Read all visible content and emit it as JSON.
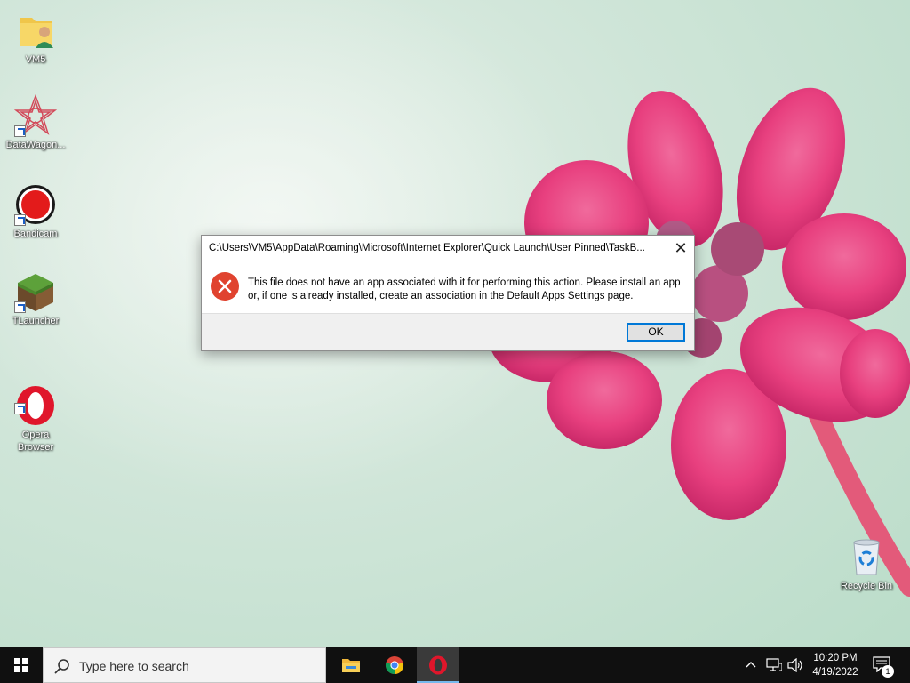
{
  "desktop": {
    "icons": [
      {
        "label": "VM5",
        "icon": "user-folder-icon"
      },
      {
        "label": "DataWagon...",
        "icon": "datawagon-icon"
      },
      {
        "label": "Bandicam",
        "icon": "bandicam-icon"
      },
      {
        "label": "TLauncher",
        "icon": "minecraft-block-icon"
      },
      {
        "label": "Opera\nBrowser",
        "icon": "opera-icon"
      },
      {
        "label": "Recycle Bin",
        "icon": "recycle-bin-icon"
      }
    ]
  },
  "dialog": {
    "title": "C:\\Users\\VM5\\AppData\\Roaming\\Microsoft\\Internet Explorer\\Quick Launch\\User Pinned\\TaskB...",
    "close_label": "✕",
    "message": "This file does not have an app associated with it for performing this action. Please install an app or, if one is already installed, create an association in the Default Apps Settings page.",
    "ok_label": "OK",
    "icon": "error-icon"
  },
  "taskbar": {
    "search_placeholder": "Type here to search",
    "apps": [
      "file-explorer-icon",
      "chrome-icon",
      "opera-icon"
    ],
    "clock_time": "10:20 PM",
    "clock_date": "4/19/2022",
    "notification_count": "1"
  },
  "colors": {
    "dialog_ok_border": "#0078d7",
    "error_red": "#e0432f",
    "taskbar_bg": "#101010"
  }
}
